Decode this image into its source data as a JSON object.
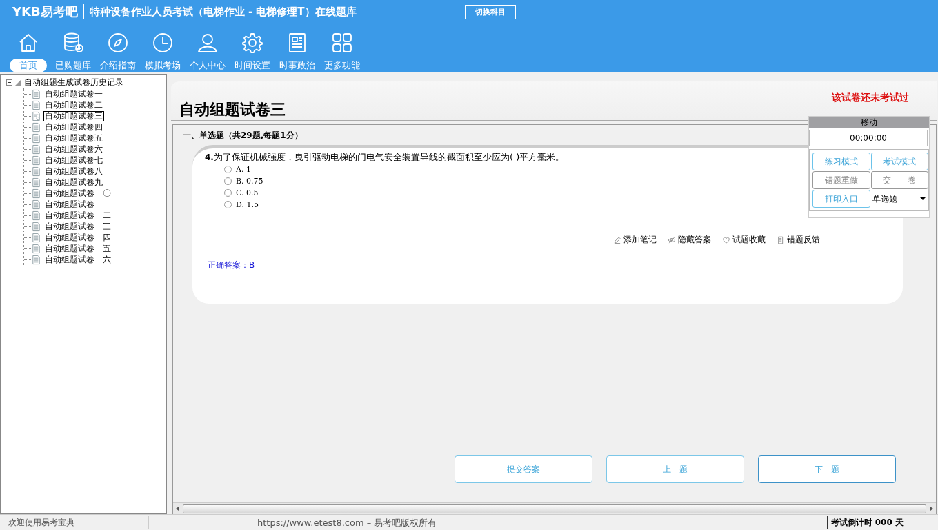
{
  "header": {
    "logo": "YKB易考吧",
    "title": "特种设备作业人员考试（电梯作业 - 电梯修理T）在线题库",
    "switch_button": "切换科目"
  },
  "nav": [
    {
      "label": "首页",
      "selected": true
    },
    {
      "label": "已购题库",
      "selected": false
    },
    {
      "label": "介绍指南",
      "selected": false
    },
    {
      "label": "模拟考场",
      "selected": false
    },
    {
      "label": "个人中心",
      "selected": false
    },
    {
      "label": "时间设置",
      "selected": false
    },
    {
      "label": "时事政治",
      "selected": false
    },
    {
      "label": "更多功能",
      "selected": false
    }
  ],
  "tree": {
    "label": "自动组题生成试卷历史记录",
    "expanded": true,
    "children": [
      {
        "label": "自动组题试卷一",
        "selected": false
      },
      {
        "label": "自动组题试卷二",
        "selected": false
      },
      {
        "label": "自动组题试卷三",
        "selected": true
      },
      {
        "label": "自动组题试卷四",
        "selected": false
      },
      {
        "label": "自动组题试卷五",
        "selected": false
      },
      {
        "label": "自动组题试卷六",
        "selected": false
      },
      {
        "label": "自动组题试卷七",
        "selected": false
      },
      {
        "label": "自动组题试卷八",
        "selected": false
      },
      {
        "label": "自动组题试卷九",
        "selected": false
      },
      {
        "label": "自动组题试卷一〇",
        "selected": false
      },
      {
        "label": "自动组题试卷一一",
        "selected": false
      },
      {
        "label": "自动组题试卷一二",
        "selected": false
      },
      {
        "label": "自动组题试卷一三",
        "selected": false
      },
      {
        "label": "自动组题试卷一四",
        "selected": false
      },
      {
        "label": "自动组题试卷一五",
        "selected": false
      },
      {
        "label": "自动组题试卷一六",
        "selected": false
      }
    ]
  },
  "paper": {
    "title": "自动组题试卷三",
    "status": "该试卷还未考试过"
  },
  "section": "一、单选题（共29题,每题1分）",
  "question": {
    "number": "4.",
    "text": "为了保证机械强度，曳引驱动电梯的门电气安全装置导线的截面积至少应为( )平方毫米。",
    "options": [
      {
        "label": "A. 1",
        "selected": false
      },
      {
        "label": "B. 0.75",
        "selected": false
      },
      {
        "label": "C. 0.5",
        "selected": false
      },
      {
        "label": "D. 1.5",
        "selected": false
      }
    ],
    "answer": "正确答案：B"
  },
  "actions": [
    "添加笔记",
    "隐藏答案",
    "试题收藏",
    "错题反馈"
  ],
  "panel": {
    "title": "移动",
    "timer": "00:00:00",
    "buttons": [
      {
        "label": "练习模式",
        "kind": "accent"
      },
      {
        "label": "考试模式",
        "kind": "accent"
      },
      {
        "label": "错题重做",
        "kind": "plain"
      },
      {
        "label": "交　　卷",
        "kind": "plain"
      },
      {
        "label": "打印入口",
        "kind": "accent"
      }
    ],
    "type_select": "单选题"
  },
  "nav_buttons": [
    "提交答案",
    "上一题",
    "下一题"
  ],
  "status_bar": {
    "welcome": "欢迎使用易考宝典",
    "copyright": "https://www.etest8.com – 易考吧版权所有",
    "countdown": "考试倒计时 000 天"
  }
}
